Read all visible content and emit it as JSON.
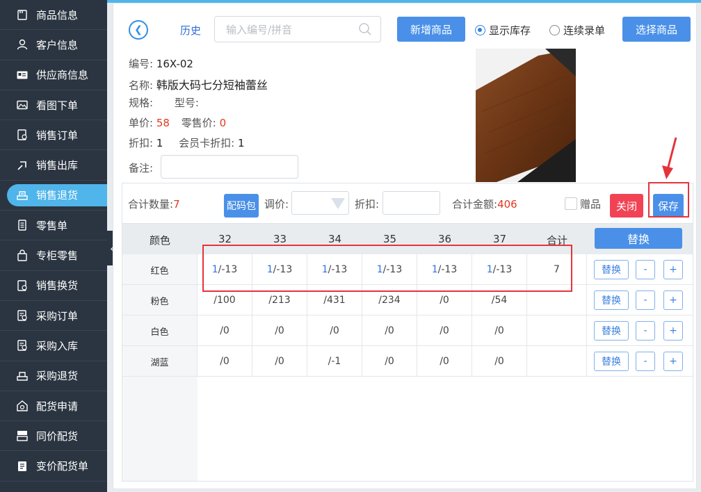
{
  "sidebar": {
    "items": [
      {
        "label": "商品信息",
        "icon": "product-icon"
      },
      {
        "label": "客户信息",
        "icon": "person-icon"
      },
      {
        "label": "供应商信息",
        "icon": "id-card-icon"
      },
      {
        "label": "看图下单",
        "icon": "image-order-icon"
      },
      {
        "label": "销售订单",
        "icon": "sales-order-icon"
      },
      {
        "label": "销售出库",
        "icon": "outbound-icon"
      },
      {
        "label": "销售退货",
        "icon": "return-icon",
        "active": true
      },
      {
        "label": "零售单",
        "icon": "receipt-icon"
      },
      {
        "label": "专柜零售",
        "icon": "bag-icon"
      },
      {
        "label": "销售换货",
        "icon": "exchange-icon"
      },
      {
        "label": "采购订单",
        "icon": "purchase-order-icon"
      },
      {
        "label": "采购入库",
        "icon": "inbound-icon"
      },
      {
        "label": "采购退货",
        "icon": "purchase-return-icon"
      },
      {
        "label": "配货申请",
        "icon": "apply-icon"
      },
      {
        "label": "同价配货",
        "icon": "same-price-icon"
      },
      {
        "label": "变价配货单",
        "icon": "price-change-icon"
      }
    ],
    "collapse_glyph": "«"
  },
  "header": {
    "history_label": "历史",
    "search_placeholder": "输入编号/拼音",
    "new_product_label": "新增商品",
    "show_stock_label": "显示库存",
    "continuous_entry_label": "连续录单",
    "select_product_label": "选择商品"
  },
  "product": {
    "code_label": "编号:",
    "code": "16X-02",
    "name_label": "名称:",
    "name": "韩版大码七分短袖蕾丝",
    "spec_label": "规格:",
    "model_label": "型号:",
    "unit_price_label": "单价:",
    "unit_price": "58",
    "retail_price_label": "零售价:",
    "retail_price": "0",
    "discount_label": "折扣:",
    "discount": "1",
    "member_discount_label": "会员卡折扣:",
    "member_discount": "1",
    "remark_label": "备注:"
  },
  "toolbar": {
    "total_qty_label": "合计数量:",
    "total_qty": "7",
    "size_pack_label": "配码包",
    "adjust_price_label": "调价:",
    "discount_label": "折扣:",
    "total_amount_label": "合计金额:",
    "total_amount": "406",
    "gift_label": "赠品",
    "close_label": "关闭",
    "save_label": "保存"
  },
  "grid": {
    "color_header": "颜色",
    "sizes": [
      "32",
      "33",
      "34",
      "35",
      "36",
      "37"
    ],
    "total_header": "合计",
    "replace_header": "替换",
    "rows": [
      {
        "color": "红色",
        "cells": [
          [
            "1",
            "/-13"
          ],
          [
            "1",
            "/-13"
          ],
          [
            "1",
            "/-13"
          ],
          [
            "1",
            "/-13"
          ],
          [
            "1",
            "/-13"
          ],
          [
            "1",
            "/-13"
          ]
        ],
        "total": "7"
      },
      {
        "color": "粉色",
        "cells": [
          [
            "",
            "/100"
          ],
          [
            "",
            "/213"
          ],
          [
            "",
            "/431"
          ],
          [
            "",
            "/234"
          ],
          [
            "",
            "/0"
          ],
          [
            "",
            "/54"
          ]
        ],
        "total": ""
      },
      {
        "color": "白色",
        "cells": [
          [
            "",
            "/0"
          ],
          [
            "",
            "/0"
          ],
          [
            "",
            "/0"
          ],
          [
            "",
            "/0"
          ],
          [
            "",
            "/0"
          ],
          [
            "",
            "/0"
          ]
        ],
        "total": ""
      },
      {
        "color": "湖蓝",
        "cells": [
          [
            "",
            "/0"
          ],
          [
            "",
            "/0"
          ],
          [
            "",
            "/-1"
          ],
          [
            "",
            "/0"
          ],
          [
            "",
            "/0"
          ],
          [
            "",
            "/0"
          ]
        ],
        "total": ""
      }
    ],
    "row_replace_label": "替换",
    "minus_label": "-",
    "plus_label": "+"
  },
  "colors": {
    "sidebar_bg": "#2b3541",
    "active_pill": "#4fb5ea",
    "primary_blue": "#4a90e8",
    "danger_red": "#f24355",
    "value_red": "#e2371f",
    "annotation_red": "#e5333b"
  }
}
